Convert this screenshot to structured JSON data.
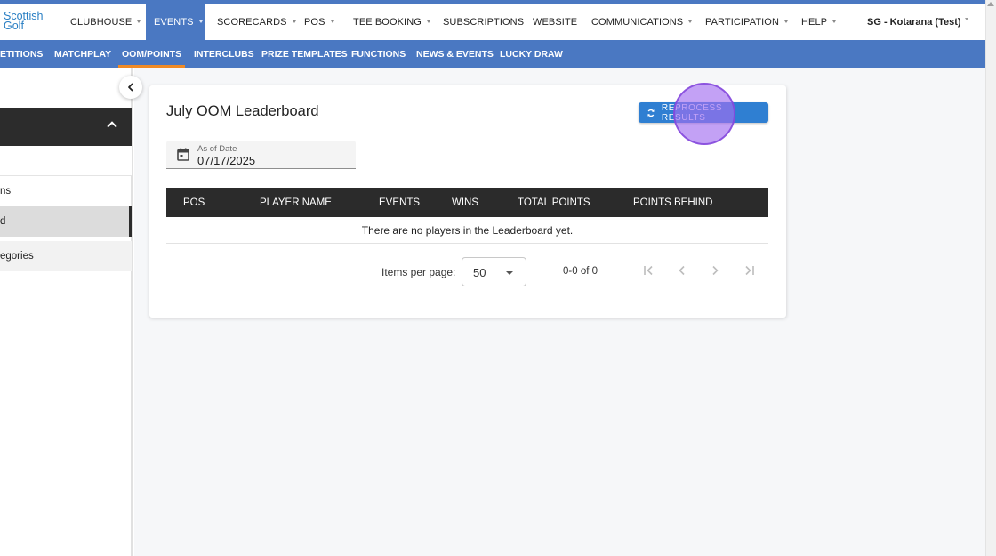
{
  "app": {
    "logo_line1": "Scottish",
    "logo_line2": "Golf",
    "user_label": "SG - Kotarana (Test)"
  },
  "main_nav": [
    {
      "label": "CLUBHOUSE",
      "has_menu": true,
      "active": false
    },
    {
      "label": "EVENTS",
      "has_menu": true,
      "active": true
    },
    {
      "label": "SCORECARDS",
      "has_menu": true,
      "active": false
    },
    {
      "label": "POS",
      "has_menu": true,
      "active": false
    },
    {
      "label": "TEE BOOKING",
      "has_menu": true,
      "active": false
    },
    {
      "label": "SUBSCRIPTIONS",
      "has_menu": false,
      "active": false
    },
    {
      "label": "WEBSITE",
      "has_menu": false,
      "active": false
    },
    {
      "label": "COMMUNICATIONS",
      "has_menu": true,
      "active": false
    },
    {
      "label": "PARTICIPATION",
      "has_menu": true,
      "active": false
    },
    {
      "label": "HELP",
      "has_menu": true,
      "active": false
    }
  ],
  "sub_nav": [
    {
      "label": "ETITIONS",
      "active": false
    },
    {
      "label": "MATCHPLAY",
      "active": false
    },
    {
      "label": "OOM/POINTS",
      "active": true
    },
    {
      "label": "INTERCLUBS",
      "active": false
    },
    {
      "label": "PRIZE TEMPLATES",
      "active": false
    },
    {
      "label": "FUNCTIONS",
      "active": false
    },
    {
      "label": "NEWS & EVENTS",
      "active": false
    },
    {
      "label": "LUCKY DRAW",
      "active": false
    }
  ],
  "sidebar": {
    "items": [
      {
        "label": "ns",
        "selected": false
      },
      {
        "label": "d",
        "selected": true
      },
      {
        "label": "egories",
        "selected": false
      }
    ]
  },
  "card": {
    "title": "July OOM Leaderboard",
    "reprocess_label": "REPROCESS RESULTS",
    "date_label": "As of Date",
    "date_value": "07/17/2025",
    "columns": [
      "POS",
      "PLAYER NAME",
      "EVENTS",
      "WINS",
      "TOTAL POINTS",
      "POINTS BEHIND"
    ],
    "empty_message": "There are no players in the Leaderboard yet.",
    "paginator": {
      "items_per_page_label": "Items per page:",
      "items_per_page_value": "50",
      "range_label": "0-0 of 0"
    }
  },
  "colors": {
    "brand_blue": "#4a78c2",
    "button_blue": "#2f7fd2",
    "active_underline": "#f08a24",
    "table_header": "#2b2b2b"
  }
}
